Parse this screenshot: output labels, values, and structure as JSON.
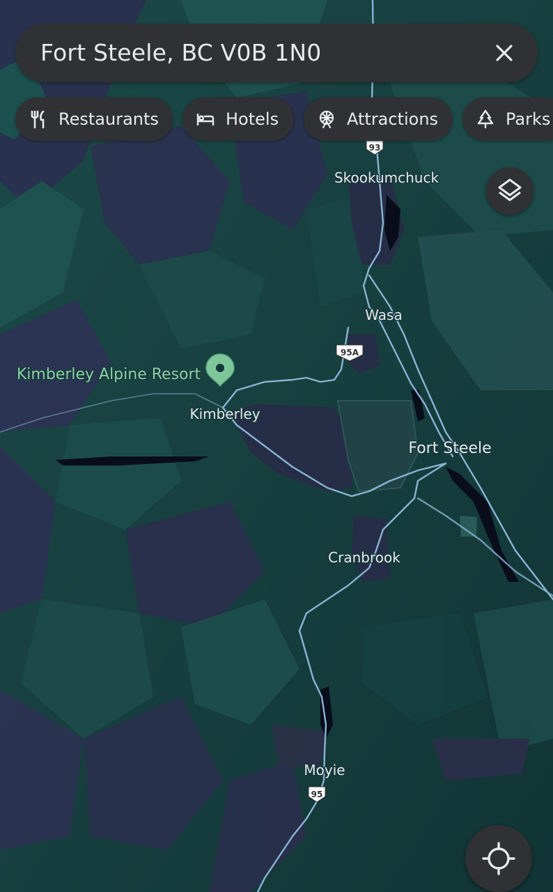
{
  "search": {
    "query": "Fort Steele, BC V0B 1N0"
  },
  "chips": [
    {
      "label": "Restaurants",
      "icon": "fork-knife-icon"
    },
    {
      "label": "Hotels",
      "icon": "bed-icon"
    },
    {
      "label": "Attractions",
      "icon": "ferris-wheel-icon"
    },
    {
      "label": "Parks",
      "icon": "tree-icon"
    }
  ],
  "map": {
    "places": {
      "skookumchuck": "Skookumchuck",
      "wasa": "Wasa",
      "kimberley": "Kimberley",
      "fort_steele": "Fort Steele",
      "cranbrook": "Cranbrook",
      "moyie": "Moyie"
    },
    "poi": {
      "label": "Kimberley Alpine Resort"
    },
    "shields": {
      "hwy93": "93",
      "hwy95a": "95A",
      "hwy95": "95"
    }
  },
  "controls": {
    "layers": "layers-icon",
    "locate": "my-location-icon"
  },
  "colors": {
    "land": "#15393a",
    "ridge_light": "#1f5250",
    "ridge_dark": "#2c2f4a",
    "urban": "#2a2e46",
    "road": "#8ab4d4",
    "chip_bg": "#303134",
    "text": "#e8eaed",
    "poi": "#8fcfa8"
  }
}
